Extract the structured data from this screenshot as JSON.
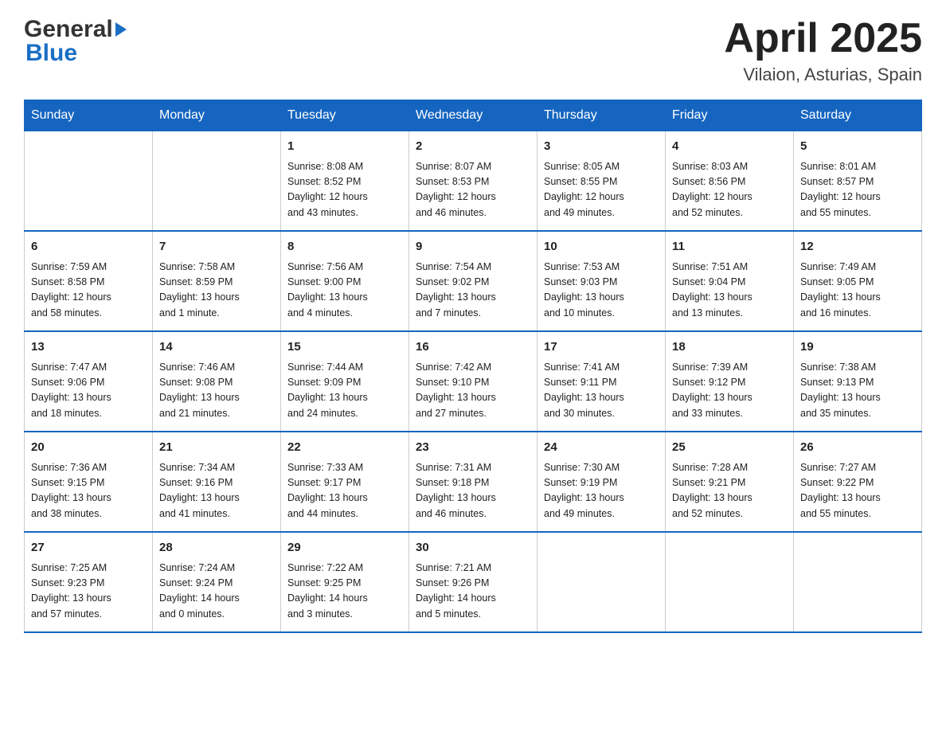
{
  "header": {
    "logo_line1": "General",
    "logo_line2": "Blue",
    "title": "April 2025",
    "subtitle": "Vilaion, Asturias, Spain"
  },
  "calendar": {
    "days_of_week": [
      "Sunday",
      "Monday",
      "Tuesday",
      "Wednesday",
      "Thursday",
      "Friday",
      "Saturday"
    ],
    "weeks": [
      [
        {
          "day": "",
          "info": ""
        },
        {
          "day": "",
          "info": ""
        },
        {
          "day": "1",
          "info": "Sunrise: 8:08 AM\nSunset: 8:52 PM\nDaylight: 12 hours\nand 43 minutes."
        },
        {
          "day": "2",
          "info": "Sunrise: 8:07 AM\nSunset: 8:53 PM\nDaylight: 12 hours\nand 46 minutes."
        },
        {
          "day": "3",
          "info": "Sunrise: 8:05 AM\nSunset: 8:55 PM\nDaylight: 12 hours\nand 49 minutes."
        },
        {
          "day": "4",
          "info": "Sunrise: 8:03 AM\nSunset: 8:56 PM\nDaylight: 12 hours\nand 52 minutes."
        },
        {
          "day": "5",
          "info": "Sunrise: 8:01 AM\nSunset: 8:57 PM\nDaylight: 12 hours\nand 55 minutes."
        }
      ],
      [
        {
          "day": "6",
          "info": "Sunrise: 7:59 AM\nSunset: 8:58 PM\nDaylight: 12 hours\nand 58 minutes."
        },
        {
          "day": "7",
          "info": "Sunrise: 7:58 AM\nSunset: 8:59 PM\nDaylight: 13 hours\nand 1 minute."
        },
        {
          "day": "8",
          "info": "Sunrise: 7:56 AM\nSunset: 9:00 PM\nDaylight: 13 hours\nand 4 minutes."
        },
        {
          "day": "9",
          "info": "Sunrise: 7:54 AM\nSunset: 9:02 PM\nDaylight: 13 hours\nand 7 minutes."
        },
        {
          "day": "10",
          "info": "Sunrise: 7:53 AM\nSunset: 9:03 PM\nDaylight: 13 hours\nand 10 minutes."
        },
        {
          "day": "11",
          "info": "Sunrise: 7:51 AM\nSunset: 9:04 PM\nDaylight: 13 hours\nand 13 minutes."
        },
        {
          "day": "12",
          "info": "Sunrise: 7:49 AM\nSunset: 9:05 PM\nDaylight: 13 hours\nand 16 minutes."
        }
      ],
      [
        {
          "day": "13",
          "info": "Sunrise: 7:47 AM\nSunset: 9:06 PM\nDaylight: 13 hours\nand 18 minutes."
        },
        {
          "day": "14",
          "info": "Sunrise: 7:46 AM\nSunset: 9:08 PM\nDaylight: 13 hours\nand 21 minutes."
        },
        {
          "day": "15",
          "info": "Sunrise: 7:44 AM\nSunset: 9:09 PM\nDaylight: 13 hours\nand 24 minutes."
        },
        {
          "day": "16",
          "info": "Sunrise: 7:42 AM\nSunset: 9:10 PM\nDaylight: 13 hours\nand 27 minutes."
        },
        {
          "day": "17",
          "info": "Sunrise: 7:41 AM\nSunset: 9:11 PM\nDaylight: 13 hours\nand 30 minutes."
        },
        {
          "day": "18",
          "info": "Sunrise: 7:39 AM\nSunset: 9:12 PM\nDaylight: 13 hours\nand 33 minutes."
        },
        {
          "day": "19",
          "info": "Sunrise: 7:38 AM\nSunset: 9:13 PM\nDaylight: 13 hours\nand 35 minutes."
        }
      ],
      [
        {
          "day": "20",
          "info": "Sunrise: 7:36 AM\nSunset: 9:15 PM\nDaylight: 13 hours\nand 38 minutes."
        },
        {
          "day": "21",
          "info": "Sunrise: 7:34 AM\nSunset: 9:16 PM\nDaylight: 13 hours\nand 41 minutes."
        },
        {
          "day": "22",
          "info": "Sunrise: 7:33 AM\nSunset: 9:17 PM\nDaylight: 13 hours\nand 44 minutes."
        },
        {
          "day": "23",
          "info": "Sunrise: 7:31 AM\nSunset: 9:18 PM\nDaylight: 13 hours\nand 46 minutes."
        },
        {
          "day": "24",
          "info": "Sunrise: 7:30 AM\nSunset: 9:19 PM\nDaylight: 13 hours\nand 49 minutes."
        },
        {
          "day": "25",
          "info": "Sunrise: 7:28 AM\nSunset: 9:21 PM\nDaylight: 13 hours\nand 52 minutes."
        },
        {
          "day": "26",
          "info": "Sunrise: 7:27 AM\nSunset: 9:22 PM\nDaylight: 13 hours\nand 55 minutes."
        }
      ],
      [
        {
          "day": "27",
          "info": "Sunrise: 7:25 AM\nSunset: 9:23 PM\nDaylight: 13 hours\nand 57 minutes."
        },
        {
          "day": "28",
          "info": "Sunrise: 7:24 AM\nSunset: 9:24 PM\nDaylight: 14 hours\nand 0 minutes."
        },
        {
          "day": "29",
          "info": "Sunrise: 7:22 AM\nSunset: 9:25 PM\nDaylight: 14 hours\nand 3 minutes."
        },
        {
          "day": "30",
          "info": "Sunrise: 7:21 AM\nSunset: 9:26 PM\nDaylight: 14 hours\nand 5 minutes."
        },
        {
          "day": "",
          "info": ""
        },
        {
          "day": "",
          "info": ""
        },
        {
          "day": "",
          "info": ""
        }
      ]
    ]
  }
}
